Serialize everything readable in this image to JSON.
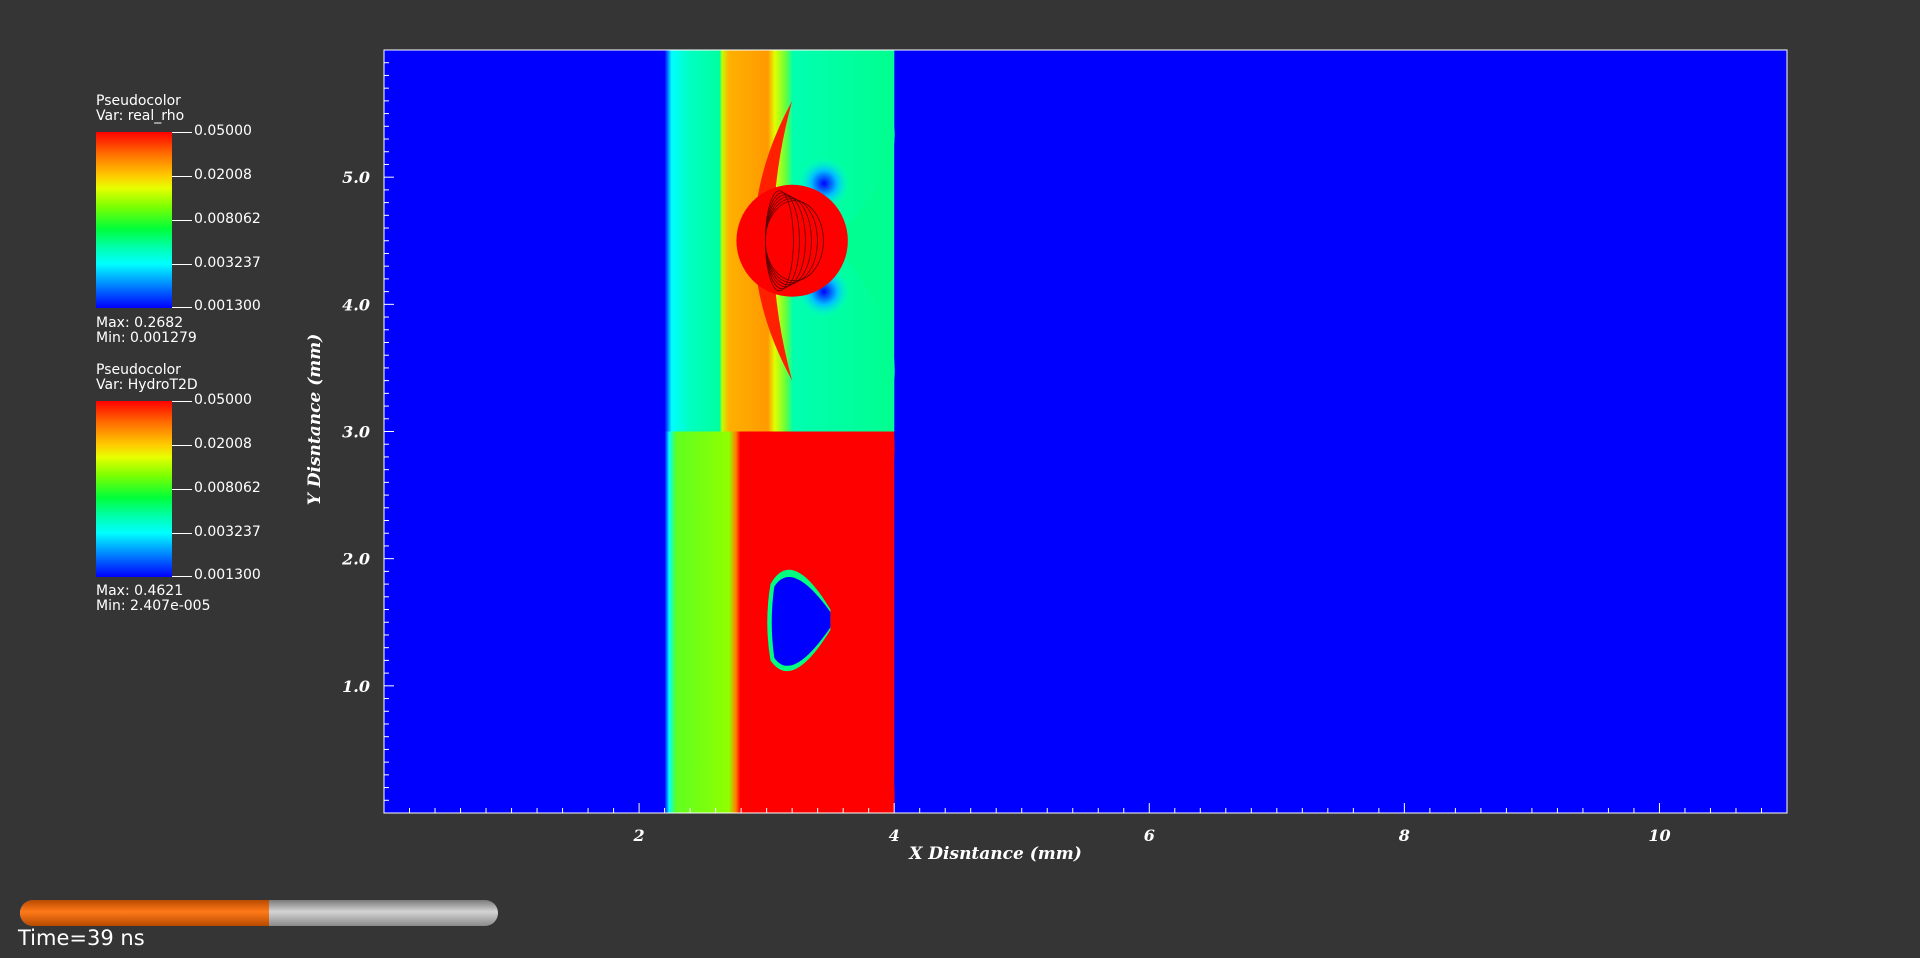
{
  "legends": [
    {
      "title": "Pseudocolor",
      "var": "Var: real_rho",
      "ticks": [
        "0.05000",
        "0.02008",
        "0.008062",
        "0.003237",
        "0.001300"
      ],
      "max": "Max:  0.2682",
      "min": "Min:  0.001279"
    },
    {
      "title": "Pseudocolor",
      "var": "Var: HydroT2D",
      "ticks": [
        "0.05000",
        "0.02008",
        "0.008062",
        "0.003237",
        "0.001300"
      ],
      "max": "Max:  0.4621",
      "min": "Min:  2.407e-005"
    }
  ],
  "chart_data": {
    "type": "heatmap",
    "title": "",
    "xlabel": "X Disntance (mm)",
    "ylabel": "Y Disntance (mm)",
    "xlim": [
      0,
      11
    ],
    "ylim": [
      0,
      6
    ],
    "x_ticks": [
      2,
      4,
      6,
      8,
      10
    ],
    "x_tick_labels": [
      "2",
      "4",
      "6",
      "8",
      "10"
    ],
    "y_ticks": [
      1.0,
      2.0,
      3.0,
      4.0,
      5.0
    ],
    "y_tick_labels": [
      "1.0",
      "2.0",
      "3.0",
      "4.0",
      "5.0"
    ],
    "colormap": [
      "#0000ff",
      "#00ffff",
      "#00ff3a",
      "#ffff00",
      "#ff0000"
    ],
    "background_color": "#0000ff",
    "regions": [
      {
        "name": "real_rho",
        "y_range": [
          3.0,
          6.0
        ]
      },
      {
        "name": "HydroT2D",
        "y_range": [
          0.0,
          3.0
        ]
      }
    ]
  },
  "time": {
    "label": "Time=39 ns",
    "progress": 0.52
  }
}
